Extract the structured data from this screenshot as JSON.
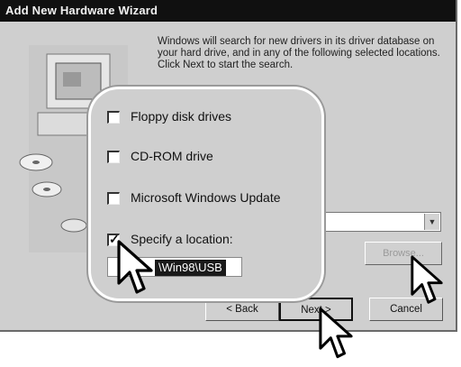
{
  "window": {
    "title": "Add New Hardware Wizard"
  },
  "description": "Windows will search for new drivers in its driver database on your hard drive, and in any of the following selected locations. Click Next to start the search.",
  "options": [
    {
      "label": "Floppy disk drives",
      "checked": false
    },
    {
      "label": "CD-ROM drive",
      "checked": false
    },
    {
      "label": "Microsoft Windows Update",
      "checked": false
    },
    {
      "label": "Specify a location:",
      "checked": true
    }
  ],
  "location": {
    "value": "\\Win98\\USB"
  },
  "buttons": {
    "browse": "Browse...",
    "back": "< Back",
    "next": "Next >",
    "cancel": "Cancel"
  },
  "icons": {
    "combo_arrow": "chevron-down-icon",
    "cursor": "mouse-pointer-icon",
    "wizard_art": "computer-cd-illustration-icon"
  }
}
